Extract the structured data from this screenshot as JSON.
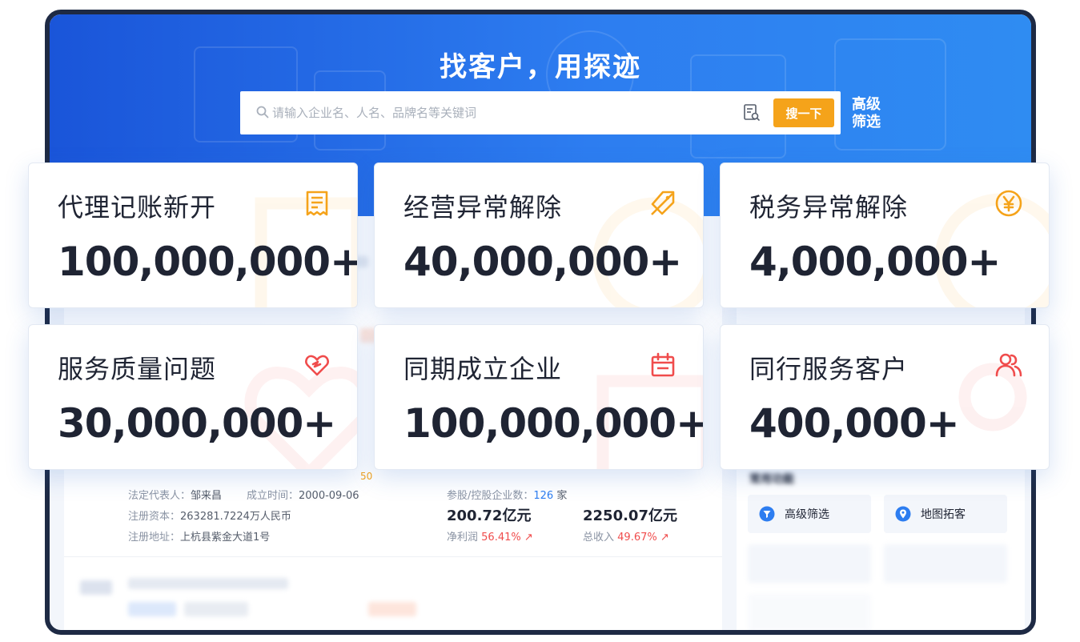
{
  "hero": {
    "title": "找客户，用探迹",
    "search_placeholder": "请输入企业名、人名、品牌名等关键词",
    "search_button": "搜一下",
    "advanced_filter": "高级筛选"
  },
  "colors": {
    "brand_blue": "#2d7df0",
    "search_button": "#f5a31a",
    "text_dark": "#1f2433",
    "icon_orange": "#f5a31a",
    "icon_red": "#f04c4c"
  },
  "cards": [
    {
      "label": "代理记账新开",
      "value": "100,000,000+",
      "icon": "receipt-icon"
    },
    {
      "label": "经营异常解除",
      "value": "40,000,000+",
      "icon": "tag-slash-icon"
    },
    {
      "label": "税务异常解除",
      "value": "4,000,000+",
      "icon": "yen-icon"
    },
    {
      "label": "服务质量问题",
      "value": "30,000,000+",
      "icon": "broken-heart-icon"
    },
    {
      "label": "同期成立企业",
      "value": "100,000,000+",
      "icon": "calendar-icon"
    },
    {
      "label": "同行服务客户",
      "value": "400,000+",
      "icon": "users-icon"
    }
  ],
  "company": {
    "badge": "50",
    "legal_rep_label": "法定代表人：",
    "legal_rep": "邹来昌",
    "founded_label": "成立时间：",
    "founded": "2000-09-06",
    "capital_label": "注册资本：",
    "capital": "263281.7224万人民币",
    "address_label": "注册地址：",
    "address": "上杭县紫金大道1号",
    "holdings_label": "参股/控股企业数：",
    "holdings": "126",
    "holdings_unit": "家",
    "net_profit_value": "200.72亿元",
    "net_profit_label": "净利润",
    "net_profit_growth": "56.41%",
    "revenue_value": "2250.07亿元",
    "revenue_label": "总收入",
    "revenue_growth": "49.67%"
  },
  "side": {
    "heading": "常用功能",
    "buttons": [
      {
        "label": "高级筛选"
      },
      {
        "label": "地图拓客"
      }
    ]
  }
}
